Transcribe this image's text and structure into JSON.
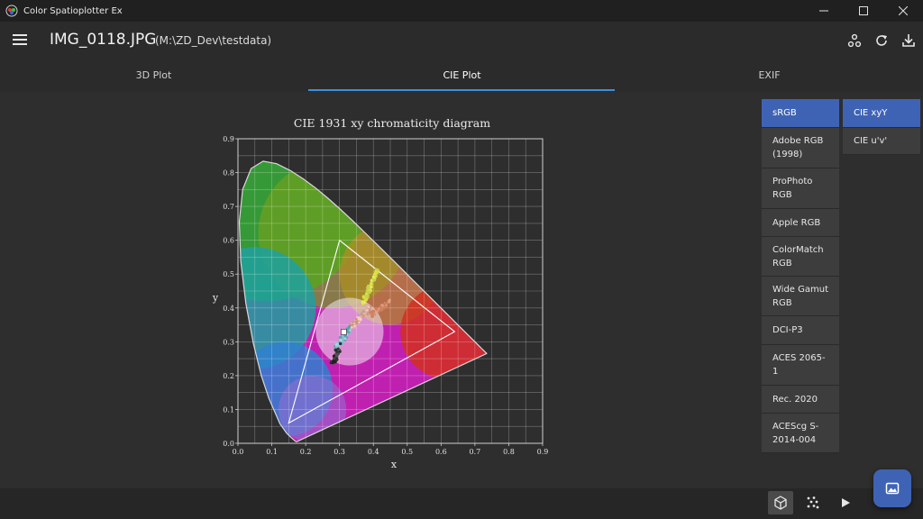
{
  "app": {
    "title": "Color Spatioplotter Ex"
  },
  "header": {
    "filename": "IMG_0118.JPG",
    "path": "(M:\\ZD_Dev\\testdata)"
  },
  "tabs": [
    {
      "label": "3D Plot"
    },
    {
      "label": "CIE Plot"
    },
    {
      "label": "EXIF"
    }
  ],
  "active_tab": "CIE Plot",
  "colorspaces": [
    {
      "label": "sRGB",
      "selected": true
    },
    {
      "label": "Adobe RGB (1998)"
    },
    {
      "label": "ProPhoto RGB"
    },
    {
      "label": "Apple RGB"
    },
    {
      "label": "ColorMatch RGB"
    },
    {
      "label": "Wide Gamut RGB"
    },
    {
      "label": "DCI-P3"
    },
    {
      "label": "ACES 2065-1"
    },
    {
      "label": "Rec. 2020"
    },
    {
      "label": "ACEScg S-2014-004"
    }
  ],
  "diagram_types": [
    {
      "label": "CIE xyY",
      "selected": true
    },
    {
      "label": "CIE u'v'"
    }
  ],
  "colors": {
    "accent": "#3c8fdc",
    "selected": "#3f63b4",
    "background": "#2e2e2e"
  },
  "chart_data": {
    "type": "scatter",
    "title": "CIE 1931 xy chromaticity diagram",
    "xlabel": "x",
    "ylabel": "y",
    "xlim": [
      0,
      0.9
    ],
    "ylim": [
      0,
      0.9
    ],
    "x_ticks": [
      "0.0",
      "0.1",
      "0.2",
      "0.3",
      "0.4",
      "0.5",
      "0.6",
      "0.7",
      "0.8",
      "0.9"
    ],
    "y_ticks": [
      "0.0",
      "0.1",
      "0.2",
      "0.3",
      "0.4",
      "0.5",
      "0.6",
      "0.7",
      "0.8",
      "0.9"
    ],
    "grid": true,
    "gamut_triangle_sRGB": [
      {
        "x": 0.64,
        "y": 0.33
      },
      {
        "x": 0.3,
        "y": 0.6
      },
      {
        "x": 0.15,
        "y": 0.06
      }
    ],
    "white_point": {
      "x": 0.3127,
      "y": 0.329
    },
    "spectral_locus": [
      [
        0.1741,
        0.005
      ],
      [
        0.1738,
        0.0049
      ],
      [
        0.1736,
        0.0049
      ],
      [
        0.1733,
        0.0048
      ],
      [
        0.1726,
        0.0048
      ],
      [
        0.1714,
        0.0051
      ],
      [
        0.1689,
        0.0069
      ],
      [
        0.1644,
        0.0109
      ],
      [
        0.1566,
        0.0177
      ],
      [
        0.144,
        0.0297
      ],
      [
        0.1241,
        0.0578
      ],
      [
        0.0913,
        0.1327
      ],
      [
        0.0687,
        0.2007
      ],
      [
        0.0454,
        0.295
      ],
      [
        0.0235,
        0.4127
      ],
      [
        0.0082,
        0.5384
      ],
      [
        0.0039,
        0.6548
      ],
      [
        0.0139,
        0.7502
      ],
      [
        0.0389,
        0.812
      ],
      [
        0.0743,
        0.8338
      ],
      [
        0.1142,
        0.8262
      ],
      [
        0.1547,
        0.8059
      ],
      [
        0.1929,
        0.7816
      ],
      [
        0.2296,
        0.7543
      ],
      [
        0.2658,
        0.7243
      ],
      [
        0.3016,
        0.6923
      ],
      [
        0.3373,
        0.6589
      ],
      [
        0.3731,
        0.6245
      ],
      [
        0.4087,
        0.5896
      ],
      [
        0.4441,
        0.5547
      ],
      [
        0.4788,
        0.5202
      ],
      [
        0.5125,
        0.4866
      ],
      [
        0.5448,
        0.4544
      ],
      [
        0.5752,
        0.4242
      ],
      [
        0.6029,
        0.3965
      ],
      [
        0.627,
        0.3725
      ],
      [
        0.6482,
        0.3514
      ],
      [
        0.6658,
        0.334
      ],
      [
        0.6801,
        0.3197
      ],
      [
        0.6915,
        0.3083
      ],
      [
        0.7006,
        0.2993
      ],
      [
        0.7079,
        0.292
      ],
      [
        0.714,
        0.2859
      ],
      [
        0.719,
        0.2809
      ],
      [
        0.723,
        0.277
      ],
      [
        0.726,
        0.274
      ],
      [
        0.7283,
        0.2717
      ],
      [
        0.73,
        0.27
      ],
      [
        0.7311,
        0.2689
      ],
      [
        0.732,
        0.268
      ],
      [
        0.7327,
        0.2673
      ],
      [
        0.7334,
        0.2666
      ],
      [
        0.734,
        0.266
      ],
      [
        0.7344,
        0.2656
      ],
      [
        0.7346,
        0.2654
      ],
      [
        0.7347,
        0.2653
      ]
    ]
  }
}
